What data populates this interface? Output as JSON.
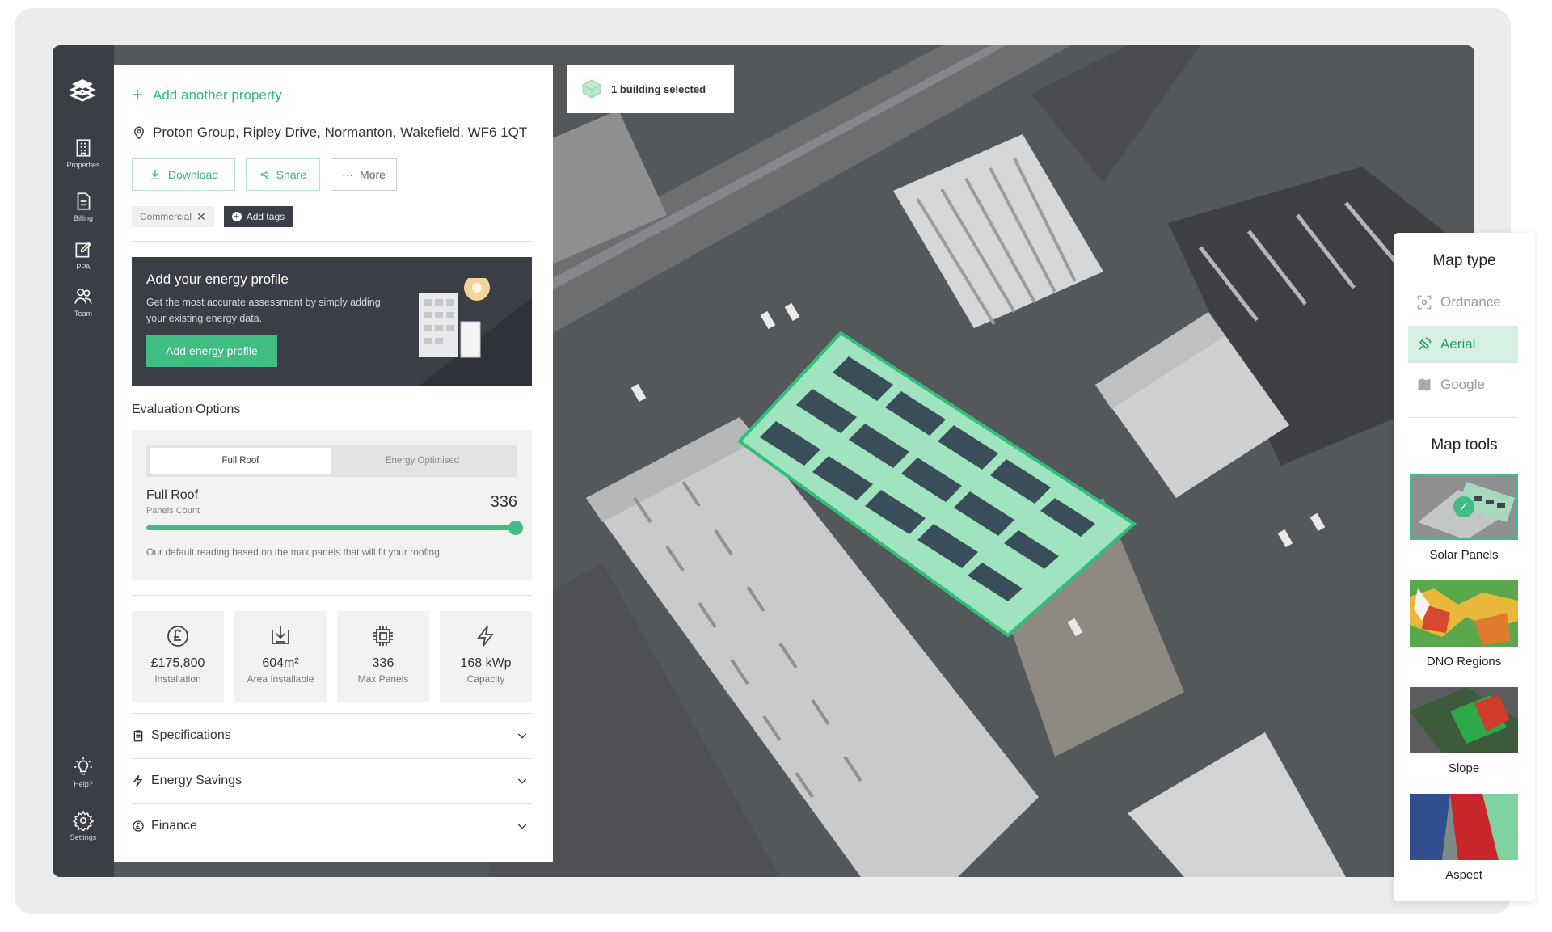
{
  "rail": {
    "items": [
      {
        "label": "Properties"
      },
      {
        "label": "Billing"
      },
      {
        "label": "PPA"
      },
      {
        "label": "Team"
      },
      {
        "label": "Help?"
      },
      {
        "label": "Settings"
      }
    ]
  },
  "panel": {
    "add_property": "Add another property",
    "address": "Proton Group, Ripley Drive, Normanton, Wakefield, WF6 1QT",
    "buttons": {
      "download": "Download",
      "share": "Share",
      "more": "More"
    },
    "tags": {
      "commercial": "Commercial",
      "add_tags": "Add tags"
    },
    "energy_card": {
      "title": "Add your energy profile",
      "text": "Get the most accurate assessment by simply adding your existing energy data.",
      "cta": "Add energy profile"
    },
    "evaluation": {
      "title": "Evaluation Options",
      "tabs": [
        "Full Roof",
        "Energy Optimised"
      ],
      "active_tab": "Full Roof",
      "heading": "Full Roof",
      "sub": "Panels Count",
      "value": "336",
      "slider_fraction": 1.0,
      "note": "Our default reading based on the max panels that will fit your roofing."
    },
    "stats": [
      {
        "value": "£175,800",
        "label": "Installation",
        "icon": "pound-icon"
      },
      {
        "value": "604m²",
        "label": "Area Installable",
        "icon": "download-box-icon"
      },
      {
        "value": "336",
        "label": "Max Panels",
        "icon": "chip-icon"
      },
      {
        "value": "168 kWp",
        "label": "Capacity",
        "icon": "bolt-icon"
      }
    ],
    "accordions": [
      "Specifications",
      "Energy Savings",
      "Finance"
    ]
  },
  "chip": {
    "label": "1 building selected"
  },
  "map_panel": {
    "map_type_title": "Map type",
    "map_types": [
      "Ordnance",
      "Aerial",
      "Google"
    ],
    "active_map_type": "Aerial",
    "map_tools_title": "Map tools",
    "tools": [
      "Solar Panels",
      "DNO Regions",
      "Slope",
      "Aspect"
    ],
    "active_tool": "Solar Panels"
  },
  "colors": {
    "accent": "#3fbd83",
    "dark": "#3b3e45"
  }
}
